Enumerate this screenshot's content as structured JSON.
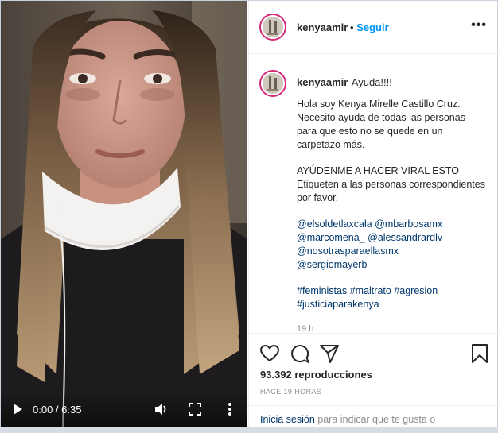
{
  "post": {
    "username": "kenyaamir",
    "follow_separator": "•",
    "follow_label": "Seguir",
    "menu_label": "•••"
  },
  "caption": {
    "username": "kenyaamir",
    "first_line": "Ayuda!!!!",
    "paragraph1": "Hola soy Kenya Mirelle Castillo Cruz. Necesito ayuda de todas las personas para que esto no se quede en un carpetazo más.",
    "paragraph2_line1": "AYÚDENME A HACER VIRAL ESTO",
    "paragraph2_line2": "Etiqueten a las personas correspondientes por favor.",
    "mentions": [
      "@elsoldetlaxcala",
      "@mbarbosamx",
      "@marcomena_",
      "@alessandrardlv",
      "@nosotrasparaellasmx",
      "@sergiomayerb"
    ],
    "hashtags": [
      "#feministas",
      "#maltrato",
      "#agresion",
      "#justiciaparakenya"
    ],
    "time": "19 h"
  },
  "actions": {
    "views": "93.392 reproducciones",
    "ago": "HACE 19 HORAS",
    "login_link": "Inicia sesión",
    "login_rest": " para indicar que te gusta o"
  },
  "video": {
    "time_display": "0:00 / 6:35",
    "progress_fraction": 0.0
  },
  "icons": {
    "play": "play-icon",
    "volume": "volume-icon",
    "fullscreen": "fullscreen-icon",
    "more": "more-vertical-icon",
    "like": "heart-icon",
    "comment": "comment-icon",
    "share": "paper-plane-icon",
    "save": "bookmark-icon"
  },
  "colors": {
    "accent": "#0095f6",
    "link": "#00376b",
    "muted": "#8e8e8e",
    "avatar_ring": "#d62976"
  }
}
